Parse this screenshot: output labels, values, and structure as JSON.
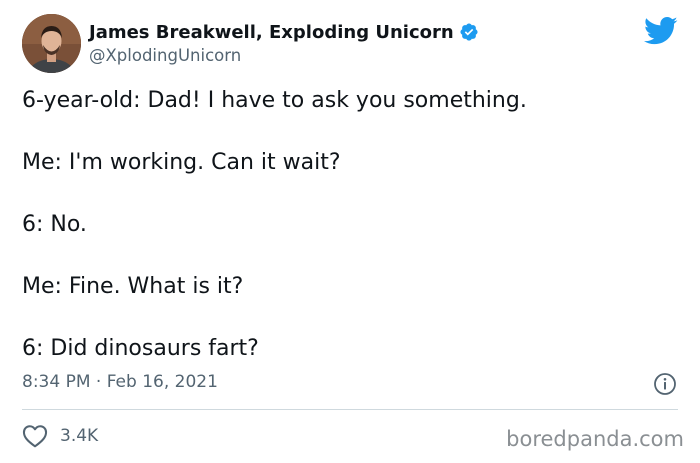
{
  "author": {
    "display_name": "James Breakwell, Exploding Unicorn",
    "handle": "@XplodingUnicorn",
    "verified_icon": "verified-badge-icon"
  },
  "tweet": {
    "lines": [
      "6-year-old: Dad! I have to ask you something.",
      "Me: I'm working. Can it wait?",
      "6: No.",
      "Me: Fine. What is it?",
      "6: Did dinosaurs fart?"
    ],
    "timestamp": "8:34 PM · Feb 16, 2021"
  },
  "engagement": {
    "likes": "3.4K"
  },
  "watermark": "boredpanda.com",
  "colors": {
    "twitter_blue": "#1d9bf0",
    "secondary_text": "#536471",
    "divider": "#cfd9de"
  }
}
